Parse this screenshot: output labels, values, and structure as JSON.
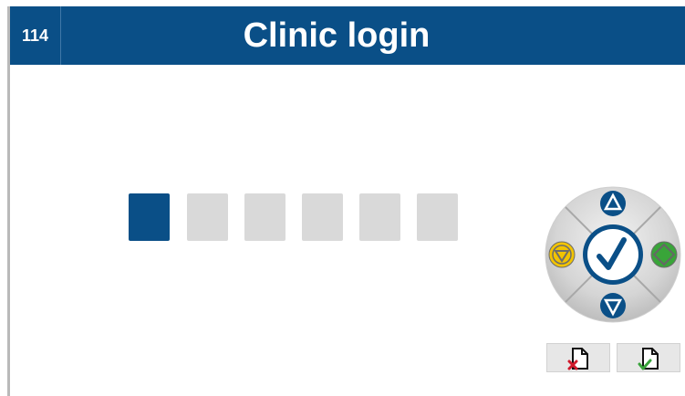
{
  "header": {
    "screen_number": "114",
    "title": "Clinic login",
    "bg_color": "#0a4f87"
  },
  "pin": {
    "length": 6,
    "filled": 1,
    "active_color": "#0a4f87",
    "empty_color": "#d9d9d9"
  },
  "nav_wheel": {
    "up_icon": "triangle-up-icon",
    "down_icon": "triangle-down-icon",
    "left_icon": "yellow-down-icon",
    "right_icon": "green-diamond-icon",
    "center_icon": "checkmark-icon"
  },
  "actions": {
    "cancel_icon": "document-x-icon",
    "confirm_icon": "document-check-icon"
  }
}
